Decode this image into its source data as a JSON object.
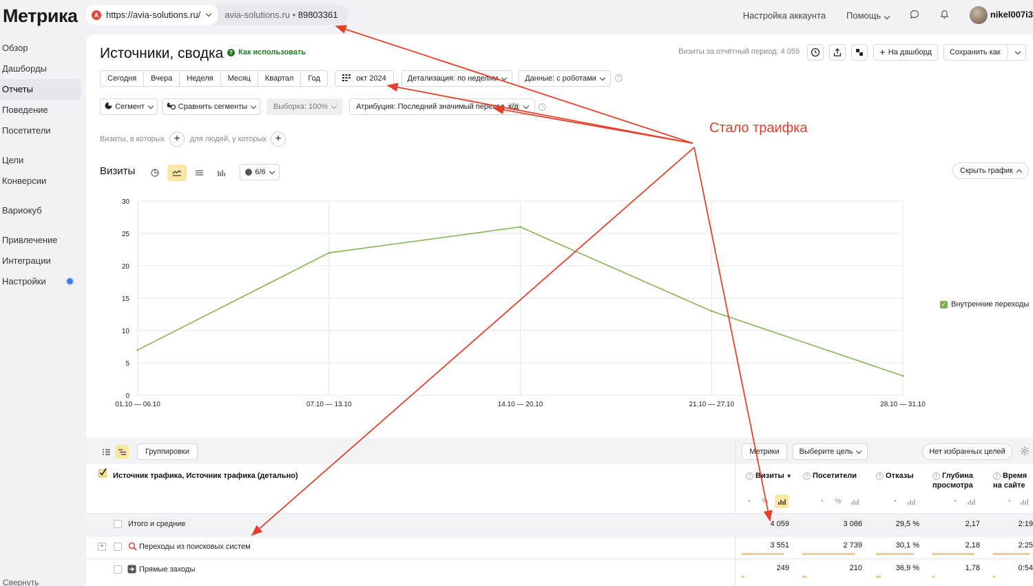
{
  "app": {
    "logo": "Метрика"
  },
  "sidebar": {
    "items": [
      {
        "label": "Обзор"
      },
      {
        "label": "Дашборды"
      },
      {
        "label": "Отчеты"
      },
      {
        "label": "Поведение"
      },
      {
        "label": "Посетители"
      },
      {
        "label": "Цели"
      },
      {
        "label": "Конверсии"
      },
      {
        "label": "Вариокуб"
      },
      {
        "label": "Привлечение"
      },
      {
        "label": "Интеграции"
      },
      {
        "label": "Настройки"
      }
    ],
    "active": "Отчеты",
    "collapse": "Свернуть"
  },
  "topbar": {
    "url": "https://avia-solutions.ru/",
    "host": "avia-solutions.ru",
    "counter": "89803361",
    "account_settings": "Настройка аккаунта",
    "help": "Помощь",
    "username": "nikel007i3"
  },
  "page": {
    "title": "Источники, сводка",
    "howto": "Как использовать",
    "visits_period": "Визиты за отчётный период: 4 059",
    "to_dashboard": "На дашборд",
    "save_as": "Сохранить как"
  },
  "periods": [
    "Сегодня",
    "Вчера",
    "Неделя",
    "Месяц",
    "Квартал",
    "Год"
  ],
  "date_range": "окт 2024",
  "detail": "Детализация: по неделям",
  "data_mode": "Данные: с роботами",
  "segment": "Сегмент",
  "compare": "Сравнить сегменты",
  "sample": "Выборка: 100%",
  "attribution": "Атрибуция: Последний значимый переход",
  "attribution_tag": "к/д",
  "filters": {
    "visits_where": "Визиты, в которых",
    "people_where": "для людей, у которых"
  },
  "chart_header": {
    "title": "Визиты",
    "series_count": "6/6",
    "hide": "Скрыть график"
  },
  "chart_data": {
    "type": "line",
    "x": [
      "01.10 — 06.10",
      "07.10 — 13.10",
      "14.10 — 20.10",
      "21.10 — 27.10",
      "28.10 — 31.10"
    ],
    "series": [
      {
        "name": "Внутренние переходы",
        "values": [
          7,
          22,
          26,
          13,
          3
        ],
        "color": "#86b554"
      }
    ],
    "ylim": [
      0,
      30
    ],
    "yticks": [
      0,
      5,
      10,
      15,
      20,
      25,
      30
    ],
    "grid": true,
    "legend": "right"
  },
  "table": {
    "groupings": "Группировки",
    "metrics": "Метрики",
    "choose_goal": "Выберите цель",
    "no_fav_goals": "Нет избранных целей",
    "dim_header": "Источник трафика, Источник трафика (детально)",
    "columns": [
      {
        "label": "Визиты",
        "sort": "▼"
      },
      {
        "label": "Посетители"
      },
      {
        "label": "Отказы"
      },
      {
        "label": "Глубина просмотра"
      },
      {
        "label": "Время на сайте"
      }
    ],
    "rows": [
      {
        "label": "Итого и средние",
        "values": [
          "4 059",
          "3 086",
          "29,5 %",
          "2,17",
          "2:19"
        ]
      },
      {
        "label": "Переходы из поисковых систем",
        "values": [
          "3 551",
          "2 739",
          "30,1 %",
          "2,18",
          "2:25"
        ]
      },
      {
        "label": "Прямые заходы",
        "values": [
          "249",
          "210",
          "36,9 %",
          "1,78",
          "0:54"
        ]
      }
    ],
    "row_shares": [
      [
        0.875,
        0.888,
        0.89,
        0.9,
        0.92
      ],
      [
        0.061,
        0.068,
        0.12,
        0.05,
        0.05
      ]
    ]
  },
  "annotation": {
    "text": "Стало траифка",
    "color": "#e6402b"
  }
}
